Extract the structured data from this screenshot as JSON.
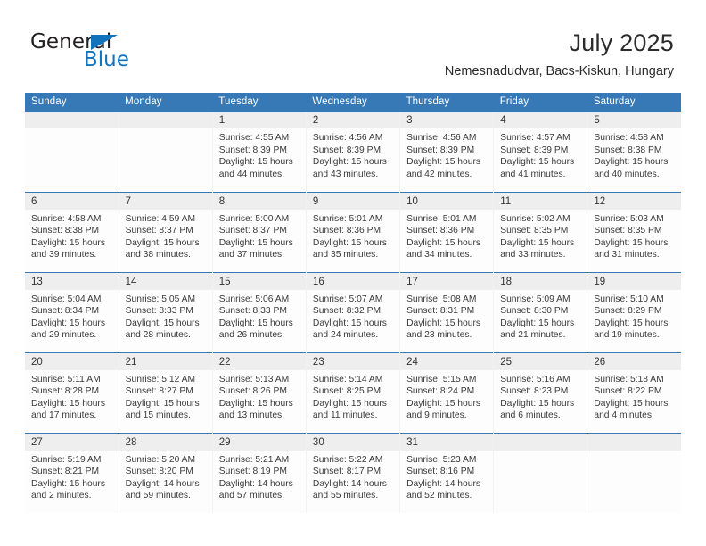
{
  "brand": {
    "name_part1": "General",
    "name_part2": "Blue",
    "triangle_icon": "triangle-icon",
    "accent_color": "#1273bd"
  },
  "header": {
    "title": "July 2025",
    "subtitle": "Nemesnadudvar, Bacs-Kiskun, Hungary",
    "header_bg_color": "#3679b6",
    "daynum_band_color": "#eeeeee"
  },
  "weekday_headers": [
    "Sunday",
    "Monday",
    "Tuesday",
    "Wednesday",
    "Thursday",
    "Friday",
    "Saturday"
  ],
  "weeks": [
    [
      {
        "day": "",
        "sunrise": "",
        "sunset": "",
        "daylight_line1": "",
        "daylight_line2": ""
      },
      {
        "day": "",
        "sunrise": "",
        "sunset": "",
        "daylight_line1": "",
        "daylight_line2": ""
      },
      {
        "day": "1",
        "sunrise": "Sunrise: 4:55 AM",
        "sunset": "Sunset: 8:39 PM",
        "daylight_line1": "Daylight: 15 hours",
        "daylight_line2": "and 44 minutes."
      },
      {
        "day": "2",
        "sunrise": "Sunrise: 4:56 AM",
        "sunset": "Sunset: 8:39 PM",
        "daylight_line1": "Daylight: 15 hours",
        "daylight_line2": "and 43 minutes."
      },
      {
        "day": "3",
        "sunrise": "Sunrise: 4:56 AM",
        "sunset": "Sunset: 8:39 PM",
        "daylight_line1": "Daylight: 15 hours",
        "daylight_line2": "and 42 minutes."
      },
      {
        "day": "4",
        "sunrise": "Sunrise: 4:57 AM",
        "sunset": "Sunset: 8:39 PM",
        "daylight_line1": "Daylight: 15 hours",
        "daylight_line2": "and 41 minutes."
      },
      {
        "day": "5",
        "sunrise": "Sunrise: 4:58 AM",
        "sunset": "Sunset: 8:38 PM",
        "daylight_line1": "Daylight: 15 hours",
        "daylight_line2": "and 40 minutes."
      }
    ],
    [
      {
        "day": "6",
        "sunrise": "Sunrise: 4:58 AM",
        "sunset": "Sunset: 8:38 PM",
        "daylight_line1": "Daylight: 15 hours",
        "daylight_line2": "and 39 minutes."
      },
      {
        "day": "7",
        "sunrise": "Sunrise: 4:59 AM",
        "sunset": "Sunset: 8:37 PM",
        "daylight_line1": "Daylight: 15 hours",
        "daylight_line2": "and 38 minutes."
      },
      {
        "day": "8",
        "sunrise": "Sunrise: 5:00 AM",
        "sunset": "Sunset: 8:37 PM",
        "daylight_line1": "Daylight: 15 hours",
        "daylight_line2": "and 37 minutes."
      },
      {
        "day": "9",
        "sunrise": "Sunrise: 5:01 AM",
        "sunset": "Sunset: 8:36 PM",
        "daylight_line1": "Daylight: 15 hours",
        "daylight_line2": "and 35 minutes."
      },
      {
        "day": "10",
        "sunrise": "Sunrise: 5:01 AM",
        "sunset": "Sunset: 8:36 PM",
        "daylight_line1": "Daylight: 15 hours",
        "daylight_line2": "and 34 minutes."
      },
      {
        "day": "11",
        "sunrise": "Sunrise: 5:02 AM",
        "sunset": "Sunset: 8:35 PM",
        "daylight_line1": "Daylight: 15 hours",
        "daylight_line2": "and 33 minutes."
      },
      {
        "day": "12",
        "sunrise": "Sunrise: 5:03 AM",
        "sunset": "Sunset: 8:35 PM",
        "daylight_line1": "Daylight: 15 hours",
        "daylight_line2": "and 31 minutes."
      }
    ],
    [
      {
        "day": "13",
        "sunrise": "Sunrise: 5:04 AM",
        "sunset": "Sunset: 8:34 PM",
        "daylight_line1": "Daylight: 15 hours",
        "daylight_line2": "and 29 minutes."
      },
      {
        "day": "14",
        "sunrise": "Sunrise: 5:05 AM",
        "sunset": "Sunset: 8:33 PM",
        "daylight_line1": "Daylight: 15 hours",
        "daylight_line2": "and 28 minutes."
      },
      {
        "day": "15",
        "sunrise": "Sunrise: 5:06 AM",
        "sunset": "Sunset: 8:33 PM",
        "daylight_line1": "Daylight: 15 hours",
        "daylight_line2": "and 26 minutes."
      },
      {
        "day": "16",
        "sunrise": "Sunrise: 5:07 AM",
        "sunset": "Sunset: 8:32 PM",
        "daylight_line1": "Daylight: 15 hours",
        "daylight_line2": "and 24 minutes."
      },
      {
        "day": "17",
        "sunrise": "Sunrise: 5:08 AM",
        "sunset": "Sunset: 8:31 PM",
        "daylight_line1": "Daylight: 15 hours",
        "daylight_line2": "and 23 minutes."
      },
      {
        "day": "18",
        "sunrise": "Sunrise: 5:09 AM",
        "sunset": "Sunset: 8:30 PM",
        "daylight_line1": "Daylight: 15 hours",
        "daylight_line2": "and 21 minutes."
      },
      {
        "day": "19",
        "sunrise": "Sunrise: 5:10 AM",
        "sunset": "Sunset: 8:29 PM",
        "daylight_line1": "Daylight: 15 hours",
        "daylight_line2": "and 19 minutes."
      }
    ],
    [
      {
        "day": "20",
        "sunrise": "Sunrise: 5:11 AM",
        "sunset": "Sunset: 8:28 PM",
        "daylight_line1": "Daylight: 15 hours",
        "daylight_line2": "and 17 minutes."
      },
      {
        "day": "21",
        "sunrise": "Sunrise: 5:12 AM",
        "sunset": "Sunset: 8:27 PM",
        "daylight_line1": "Daylight: 15 hours",
        "daylight_line2": "and 15 minutes."
      },
      {
        "day": "22",
        "sunrise": "Sunrise: 5:13 AM",
        "sunset": "Sunset: 8:26 PM",
        "daylight_line1": "Daylight: 15 hours",
        "daylight_line2": "and 13 minutes."
      },
      {
        "day": "23",
        "sunrise": "Sunrise: 5:14 AM",
        "sunset": "Sunset: 8:25 PM",
        "daylight_line1": "Daylight: 15 hours",
        "daylight_line2": "and 11 minutes."
      },
      {
        "day": "24",
        "sunrise": "Sunrise: 5:15 AM",
        "sunset": "Sunset: 8:24 PM",
        "daylight_line1": "Daylight: 15 hours",
        "daylight_line2": "and 9 minutes."
      },
      {
        "day": "25",
        "sunrise": "Sunrise: 5:16 AM",
        "sunset": "Sunset: 8:23 PM",
        "daylight_line1": "Daylight: 15 hours",
        "daylight_line2": "and 6 minutes."
      },
      {
        "day": "26",
        "sunrise": "Sunrise: 5:18 AM",
        "sunset": "Sunset: 8:22 PM",
        "daylight_line1": "Daylight: 15 hours",
        "daylight_line2": "and 4 minutes."
      }
    ],
    [
      {
        "day": "27",
        "sunrise": "Sunrise: 5:19 AM",
        "sunset": "Sunset: 8:21 PM",
        "daylight_line1": "Daylight: 15 hours",
        "daylight_line2": "and 2 minutes."
      },
      {
        "day": "28",
        "sunrise": "Sunrise: 5:20 AM",
        "sunset": "Sunset: 8:20 PM",
        "daylight_line1": "Daylight: 14 hours",
        "daylight_line2": "and 59 minutes."
      },
      {
        "day": "29",
        "sunrise": "Sunrise: 5:21 AM",
        "sunset": "Sunset: 8:19 PM",
        "daylight_line1": "Daylight: 14 hours",
        "daylight_line2": "and 57 minutes."
      },
      {
        "day": "30",
        "sunrise": "Sunrise: 5:22 AM",
        "sunset": "Sunset: 8:17 PM",
        "daylight_line1": "Daylight: 14 hours",
        "daylight_line2": "and 55 minutes."
      },
      {
        "day": "31",
        "sunrise": "Sunrise: 5:23 AM",
        "sunset": "Sunset: 8:16 PM",
        "daylight_line1": "Daylight: 14 hours",
        "daylight_line2": "and 52 minutes."
      },
      {
        "day": "",
        "sunrise": "",
        "sunset": "",
        "daylight_line1": "",
        "daylight_line2": ""
      },
      {
        "day": "",
        "sunrise": "",
        "sunset": "",
        "daylight_line1": "",
        "daylight_line2": ""
      }
    ]
  ]
}
